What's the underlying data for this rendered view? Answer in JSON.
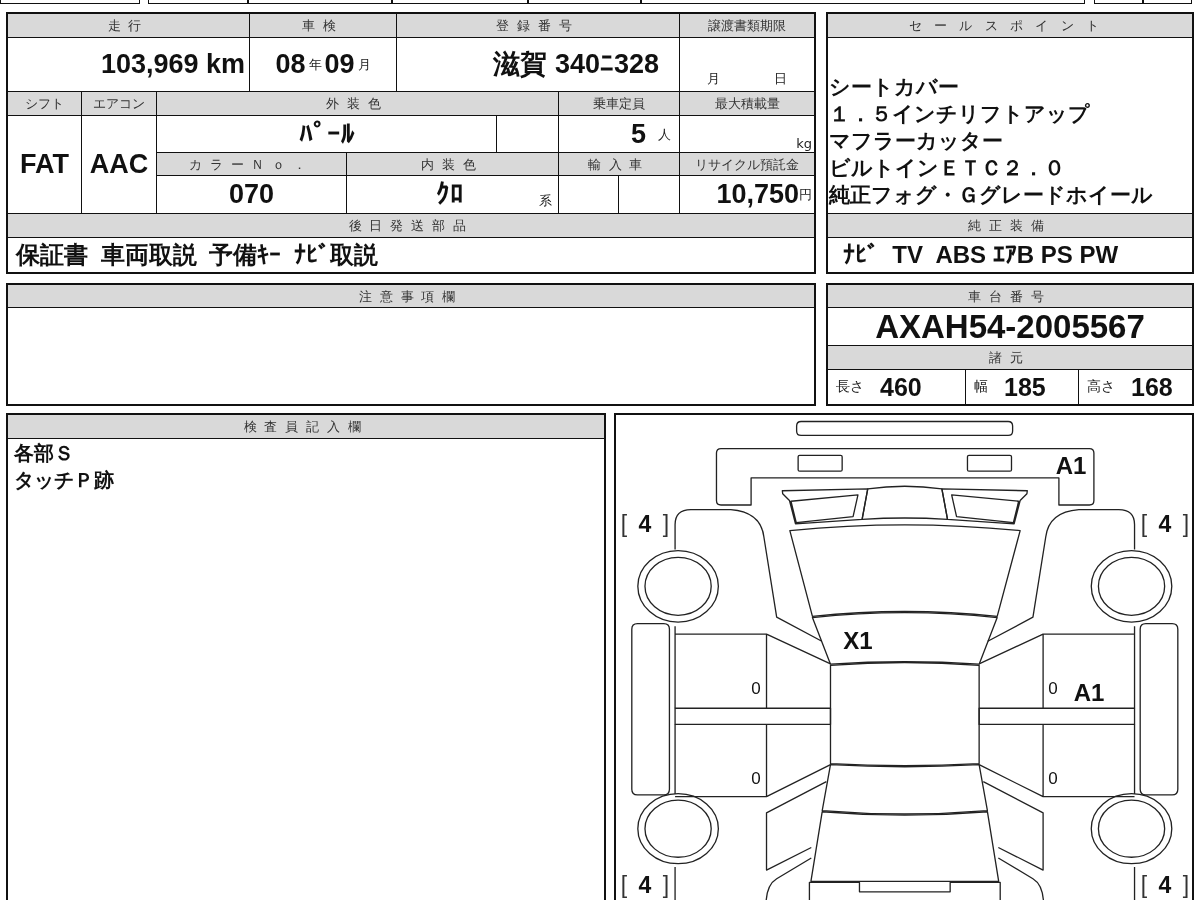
{
  "vehicle_info": {
    "mileage": {
      "label": "走行",
      "value": "103,969 km"
    },
    "inspection": {
      "label": "車検",
      "year": "08",
      "year_unit": "年",
      "month": "09",
      "month_unit": "月"
    },
    "registration": {
      "label": "登録番号",
      "value": "滋賀 340ﾆ328"
    },
    "transfer_deadline": {
      "label": "譲渡書類期限",
      "month_unit": "月",
      "day_unit": "日"
    },
    "shift": {
      "label": "シフト",
      "value": "FAT"
    },
    "air_conditioner": {
      "label": "エアコン",
      "value": "AAC"
    },
    "exterior_color": {
      "label": "外装色",
      "value": "ﾊﾟｰﾙ"
    },
    "capacity": {
      "label": "乗車定員",
      "value": "5",
      "unit": "人"
    },
    "max_load": {
      "label": "最大積載量",
      "unit": "kg"
    },
    "color_no": {
      "label": "カラーＮｏ．",
      "value": "070"
    },
    "interior_color": {
      "label": "内装色",
      "value": "ｸﾛ",
      "unit": "系"
    },
    "imported": {
      "label": "輸入車"
    },
    "recycle_deposit": {
      "label": "リサイクル預託金",
      "value": "10,750",
      "unit": "円"
    },
    "later_parts": {
      "label": "後日発送部品",
      "value": "保証書 車両取説 予備ｷｰ ﾅﾋﾞ取説"
    }
  },
  "sales_points": {
    "label": "セールスポイント",
    "lines": [
      "シートカバー",
      "１．５インチリフトアップ",
      "マフラーカッター",
      "ビルトインＥＴＣ２．０",
      "純正フォグ・Ｇグレードホイール"
    ]
  },
  "equipment": {
    "label": "純正装備",
    "value": "ﾅﾋﾞ  TV  ABS ｴｱB PS PW"
  },
  "notes": {
    "label": "注意事項欄"
  },
  "chassis": {
    "label": "車台番号",
    "value": "AXAH54-2005567"
  },
  "specs": {
    "label": "諸元",
    "items": [
      {
        "label": "長さ",
        "value": "460"
      },
      {
        "label": "幅",
        "value": "185"
      },
      {
        "label": "高さ",
        "value": "168"
      }
    ]
  },
  "inspector": {
    "label": "検査員記入欄",
    "lines": [
      "各部Ｓ",
      "タッチＰ跡"
    ]
  },
  "diagram": {
    "marks": [
      {
        "kind": "code",
        "text": "A1"
      },
      {
        "kind": "tread",
        "text": "[ **4** ]"
      },
      {
        "kind": "tread",
        "text": "[ **4** ]"
      },
      {
        "kind": "code",
        "text": "X1"
      },
      {
        "kind": "small",
        "text": "0"
      },
      {
        "kind": "small",
        "text": "0"
      },
      {
        "kind": "code",
        "text": "A1"
      },
      {
        "kind": "small",
        "text": "0"
      },
      {
        "kind": "small",
        "text": "0"
      },
      {
        "kind": "tread",
        "text": "[ **4** ]"
      },
      {
        "kind": "tread",
        "text": "[ **4** ]"
      }
    ]
  }
}
